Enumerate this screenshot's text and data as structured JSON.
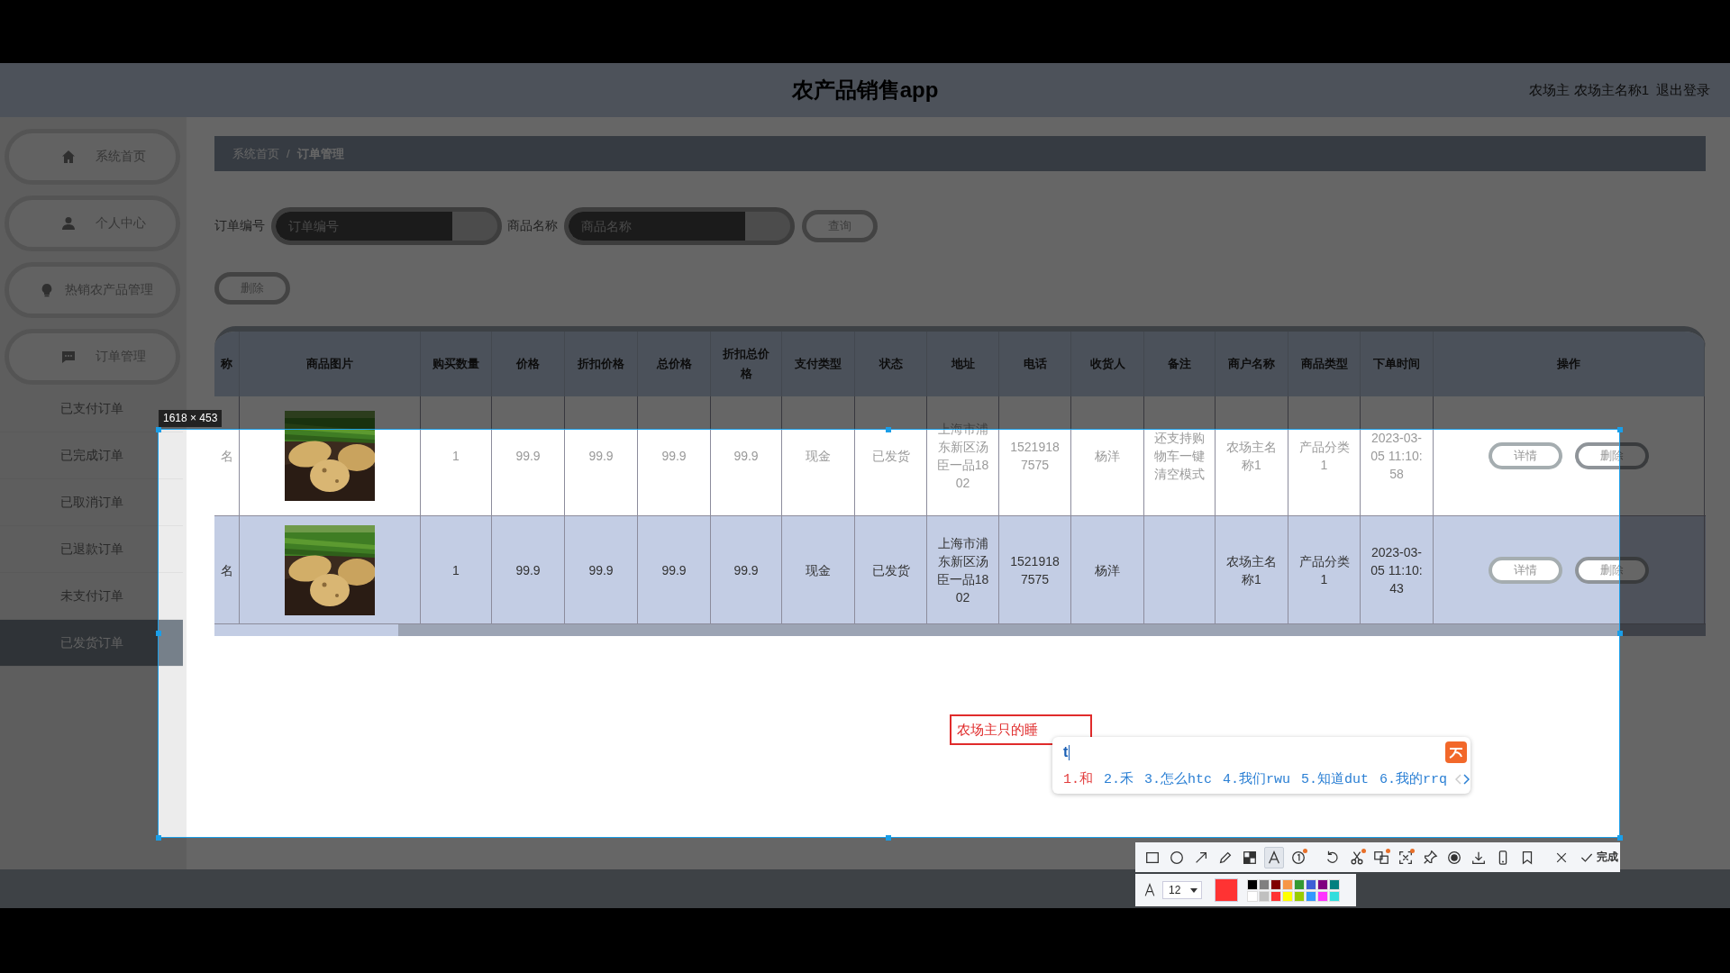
{
  "header": {
    "title": "农产品销售app",
    "user": "农场主 农场主名称1",
    "logout": "退出登录"
  },
  "sidebar": {
    "items": [
      {
        "label": "系统首页",
        "expanded": false
      },
      {
        "label": "个人中心",
        "expanded": false
      },
      {
        "label": "热销农产品管理",
        "expanded": false
      },
      {
        "label": "订单管理",
        "expanded": true,
        "children": [
          {
            "label": "已支付订单",
            "selected": false
          },
          {
            "label": "已完成订单",
            "selected": false
          },
          {
            "label": "已取消订单",
            "selected": false
          },
          {
            "label": "已退款订单",
            "selected": false
          },
          {
            "label": "未支付订单",
            "selected": false
          },
          {
            "label": "已发货订单",
            "selected": true
          }
        ]
      }
    ]
  },
  "breadcrumb": {
    "items": [
      "系统首页",
      "订单管理"
    ],
    "separator": "/"
  },
  "search": {
    "fields": [
      {
        "label": "订单编号",
        "placeholder": "订单编号"
      },
      {
        "label": "商品名称",
        "placeholder": "商品名称"
      }
    ],
    "button": "查询"
  },
  "delete_button": "删除",
  "table": {
    "columns": [
      "称",
      "商品图片",
      "购买数量",
      "价格",
      "折扣价格",
      "总价格",
      "折扣总价格",
      "支付类型",
      "状态",
      "地址",
      "电话",
      "收货人",
      "备注",
      "商户名称",
      "商品类型",
      "下单时间",
      "操作"
    ],
    "rows": [
      {
        "selected": false,
        "cells": [
          {
            "kind": "text",
            "text": "名"
          },
          {
            "kind": "picture"
          },
          {
            "kind": "text",
            "text": "1"
          },
          {
            "kind": "text",
            "text": "99.9"
          },
          {
            "kind": "text",
            "text": "99.9"
          },
          {
            "kind": "text",
            "text": "99.9"
          },
          {
            "kind": "text",
            "text": "99.9"
          },
          {
            "kind": "text",
            "text": "现金"
          },
          {
            "kind": "text",
            "text": "已发货"
          },
          {
            "kind": "text",
            "text": "上海市浦东新区汤臣一品1802"
          },
          {
            "kind": "text",
            "text": "15219187575"
          },
          {
            "kind": "text",
            "text": "杨洋"
          },
          {
            "kind": "text",
            "text": "还支持购物车一键清空模式"
          },
          {
            "kind": "text",
            "text": "农场主名称1"
          },
          {
            "kind": "text",
            "text": "产品分类1"
          },
          {
            "kind": "text",
            "text": "2023-03-05 11:10:58"
          },
          {
            "kind": "actions",
            "actions": [
              "详情",
              "删除"
            ]
          }
        ]
      },
      {
        "selected": true,
        "cells": [
          {
            "kind": "text",
            "text": "名"
          },
          {
            "kind": "picture"
          },
          {
            "kind": "text",
            "text": "1"
          },
          {
            "kind": "text",
            "text": "99.9"
          },
          {
            "kind": "text",
            "text": "99.9"
          },
          {
            "kind": "text",
            "text": "99.9"
          },
          {
            "kind": "text",
            "text": "99.9"
          },
          {
            "kind": "text",
            "text": "现金"
          },
          {
            "kind": "text",
            "text": "已发货"
          },
          {
            "kind": "text",
            "text": "上海市浦东新区汤臣一品1802"
          },
          {
            "kind": "text",
            "text": "15219187575"
          },
          {
            "kind": "text",
            "text": "杨洋"
          },
          {
            "kind": "text"
          },
          {
            "kind": "text",
            "text": "农场主名称1"
          },
          {
            "kind": "text",
            "text": "产品分类1"
          },
          {
            "kind": "text",
            "text": "2023-03-05 11:10:43"
          },
          {
            "kind": "actions",
            "actions": [
              "详情",
              "删除"
            ]
          }
        ]
      }
    ]
  },
  "screenshot_tool": {
    "size_label": "1618 × 453",
    "annotation": "农场主只的睡",
    "ime": {
      "input": "t",
      "candidates": [
        {
          "text": "1.和",
          "selected": true
        },
        {
          "text": "2.禾",
          "selected": false
        },
        {
          "text": "3.怎么htc",
          "selected": false
        },
        {
          "text": "4.我们rwu",
          "selected": false
        },
        {
          "text": "5.知道dut",
          "selected": false
        },
        {
          "text": "6.我的rrq",
          "selected": false
        }
      ]
    },
    "toolbar": {
      "tools": [
        {
          "selected": false,
          "badge": false
        },
        {
          "selected": false,
          "badge": false
        },
        {
          "selected": false,
          "badge": false
        },
        {
          "selected": false,
          "badge": false
        },
        {
          "selected": false,
          "badge": false
        },
        {
          "selected": true,
          "badge": false
        },
        {
          "selected": false,
          "badge": true
        },
        {
          "selected": false,
          "badge": false
        },
        {
          "selected": false,
          "badge": true
        },
        {
          "selected": false,
          "badge": true
        },
        {
          "selected": false,
          "badge": true
        },
        {
          "selected": false,
          "badge": false
        },
        {
          "selected": false,
          "badge": false
        },
        {
          "selected": false,
          "badge": false
        },
        {
          "selected": false,
          "badge": false
        },
        {
          "selected": false,
          "badge": false
        }
      ],
      "done": "完成"
    },
    "style_bar": {
      "font_size": "12",
      "current": {
        "color": "#ff3333"
      },
      "palette": [
        {
          "color": "#000000"
        },
        {
          "color": "#808080"
        },
        {
          "color": "#800000"
        },
        {
          "color": "#f79646"
        },
        {
          "color": "#339933"
        },
        {
          "color": "#3d5fd6"
        },
        {
          "color": "#800080"
        },
        {
          "color": "#008080"
        },
        {
          "color": "#ffffff"
        },
        {
          "color": "#c0c0c0"
        },
        {
          "color": "#ff3333"
        },
        {
          "color": "#ffff00"
        },
        {
          "color": "#99cc00"
        },
        {
          "color": "#3399ff"
        },
        {
          "color": "#ff33ff"
        },
        {
          "color": "#33dddd"
        }
      ]
    }
  }
}
